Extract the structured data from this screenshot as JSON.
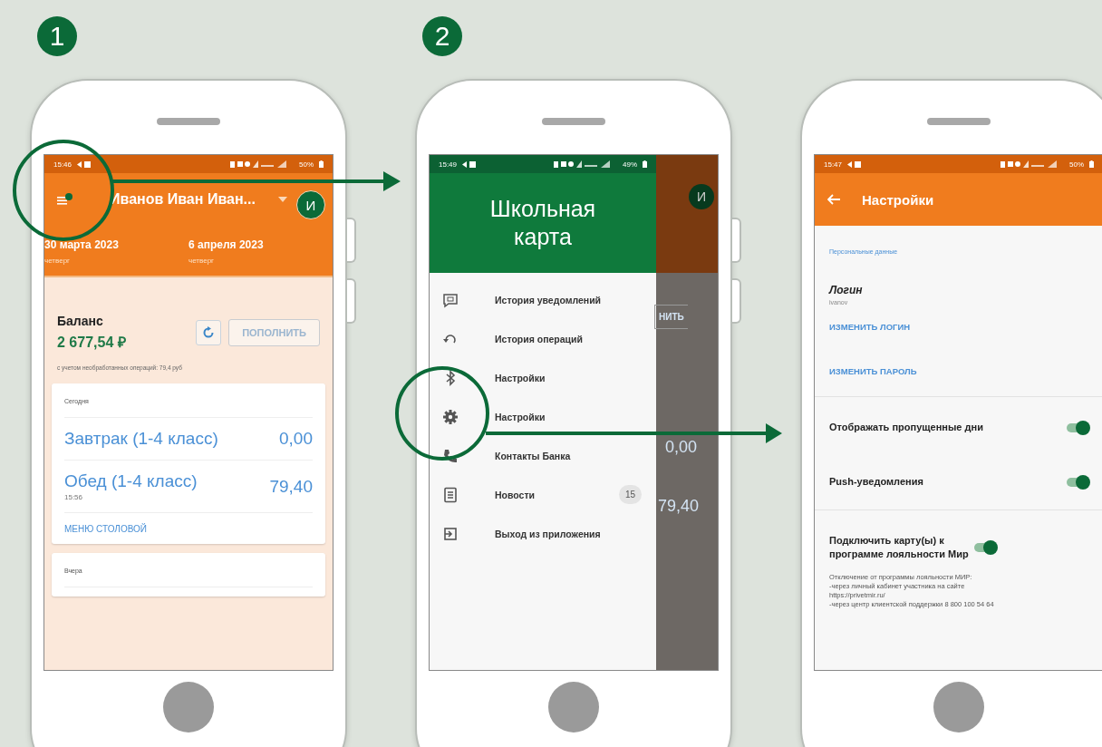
{
  "steps": [
    {
      "number": "1"
    },
    {
      "number": "2"
    }
  ],
  "phones": [
    {
      "kind": "home",
      "status": {
        "time": "15:46",
        "battery": "50%"
      },
      "header": {
        "name": "Иванов Иван Иван...",
        "avatar": "И"
      },
      "dates": [
        {
          "date": "30 марта 2023",
          "weekday": "четверг"
        },
        {
          "date": "6 апреля 2023",
          "weekday": "четверг"
        }
      ],
      "balance": {
        "label": "Баланс",
        "amount": "2 677,54 ₽",
        "top_up": "ПОПОЛНИТЬ",
        "note": "с учетом необработанных операций: 79,4 руб"
      },
      "days": [
        {
          "title": "Сегодня",
          "items": [
            {
              "name": "Завтрак (1-4 класс)",
              "amount": "0,00"
            },
            {
              "name": "Обед (1-4 класс)",
              "time": "15:56",
              "amount": "79,40"
            }
          ],
          "link": "МЕНЮ СТОЛОВОЙ"
        },
        {
          "title": "Вчера"
        }
      ]
    },
    {
      "kind": "drawer",
      "status": {
        "time": "15:49",
        "battery": "49%"
      },
      "title": "Школьная карта",
      "menu": [
        {
          "label": "История уведомлений"
        },
        {
          "label": "История операций"
        },
        {
          "label": "Настройки"
        },
        {
          "label": "Настройки"
        },
        {
          "label": "Контакты Банка"
        },
        {
          "label": "Новости",
          "badge": "15"
        },
        {
          "label": "Выход из приложения"
        }
      ],
      "behind": {
        "avatar": "И",
        "button": "НИТЬ",
        "amounts": [
          "0,00",
          "79,40"
        ]
      }
    },
    {
      "kind": "settings",
      "status": {
        "time": "15:47",
        "battery": "50%"
      },
      "title": "Настройки",
      "section": "Персональные данные",
      "login": {
        "label": "Логин",
        "value": "ivanov"
      },
      "links": [
        "ИЗМЕНИТЬ ЛОГИН",
        "ИЗМЕНИТЬ ПАРОЛЬ"
      ],
      "toggles": [
        {
          "label": "Отображать пропущенные дни",
          "on": true
        },
        {
          "label": "Push-уведомления",
          "on": true
        },
        {
          "label": "Подключить карту(ы) к программе лояльности Мир",
          "on": true,
          "description": [
            "Отключение от программы лояльности МИР:",
            "-через личный кабинет участника на сайте",
            "https://privetmir.ru/",
            "-через центр клиентской поддержки 8 800 100 54 64"
          ]
        }
      ]
    }
  ]
}
